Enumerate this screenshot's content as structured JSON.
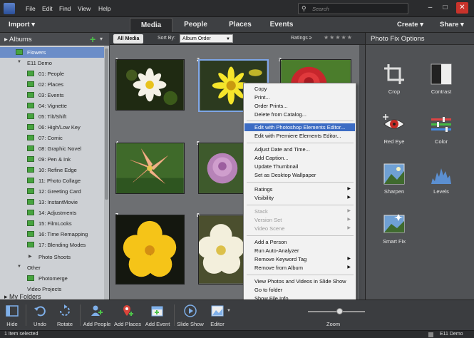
{
  "menubar": {
    "items": [
      "File",
      "Edit",
      "Find",
      "View",
      "Help"
    ],
    "search_placeholder": "Search",
    "window_buttons": [
      "–",
      "□",
      "✕"
    ]
  },
  "toolbar": {
    "import_label": "Import",
    "tabs": [
      "Media",
      "People",
      "Places",
      "Events"
    ],
    "create_label": "Create",
    "share_label": "Share"
  },
  "left_panel": {
    "header": "Albums",
    "items": [
      {
        "label": "Flowers"
      },
      {
        "label": "E11 Demo"
      },
      {
        "label": "01: People"
      },
      {
        "label": "02: Places"
      },
      {
        "label": "03: Events"
      },
      {
        "label": "04: Vignette"
      },
      {
        "label": "05: Tilt/Shift"
      },
      {
        "label": "06: High/Low Key"
      },
      {
        "label": "07: Comic"
      },
      {
        "label": "08: Graphic Novel"
      },
      {
        "label": "09: Pen & Ink"
      },
      {
        "label": "10: Refine Edge"
      },
      {
        "label": "11: Photo Collage"
      },
      {
        "label": "12: Greeting Card"
      },
      {
        "label": "13: InstantMovie"
      },
      {
        "label": "14: Adjustments"
      },
      {
        "label": "15: FilmLooks"
      },
      {
        "label": "16: Time Remapping"
      },
      {
        "label": "17: Blending Modes"
      },
      {
        "label": "Photo Shoots"
      },
      {
        "label": "Other"
      },
      {
        "label": "Photomerge"
      },
      {
        "label": "Video Projects"
      }
    ],
    "my_folders_label": "My Folders"
  },
  "center": {
    "all_media_label": "All Media",
    "sort_by_label": "Sort By:",
    "sort_value": "Album Order",
    "ratings_label": "Ratings ≥",
    "stars": "★★★★★",
    "thumb_numbers": [
      "1",
      "2",
      "3",
      "4",
      "5",
      "7",
      "8"
    ]
  },
  "context_menu": {
    "items": [
      "Copy",
      "Print...",
      "Order Prints...",
      "Delete from Catalog...",
      "Edit with Photoshop Elements Editor...",
      "Edit with Premiere Elements Editor...",
      "Adjust Date and Time...",
      "Add Caption...",
      "Update Thumbnail",
      "Set as Desktop Wallpaper",
      "Ratings",
      "Visibility",
      "Stack",
      "Version Set",
      "Video Scene",
      "Add a Person",
      "Run Auto-Analyzer",
      "Remove Keyword Tag",
      "Remove from Album",
      "View Photos and Videos in Slide Show",
      "Go to folder",
      "Show File Info"
    ]
  },
  "right_panel": {
    "header": "Photo Fix Options",
    "tools": [
      "Crop",
      "Contrast",
      "Red Eye",
      "Color",
      "Sharpen",
      "Levels",
      "Smart Fix"
    ]
  },
  "bottombar": {
    "buttons": [
      "Hide",
      "Undo",
      "Rotate",
      "Add People",
      "Add Places",
      "Add Event",
      "Slide Show",
      "Editor"
    ],
    "zoom_label": "Zoom",
    "zoom_level": 0.55
  },
  "statusbar": {
    "left": "1 Item selected",
    "right": "E11 Demo"
  },
  "colors": {
    "selection_blue": "#3c6cc4",
    "album_green": "#47a43f",
    "close_red": "#c9332b"
  }
}
